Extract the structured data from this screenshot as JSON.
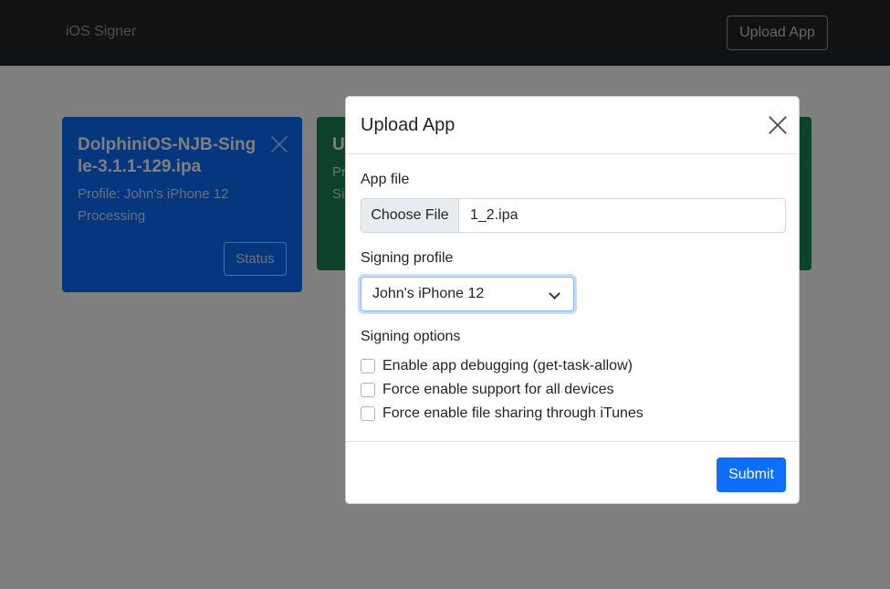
{
  "navbar": {
    "brand": "iOS Signer",
    "upload_button": "Upload App"
  },
  "cards": [
    {
      "title": "DolphiniOS-NJB-Single-3.1.1-129.ipa",
      "profile": "Profile: John's iPhone 12",
      "status_text": "Processing",
      "status_button": "Status",
      "color": "#0d6efd"
    },
    {
      "title": "U",
      "line1": "Pr",
      "line2": "Si",
      "color": "#198754"
    }
  ],
  "modal": {
    "title": "Upload App",
    "app_file_label": "App file",
    "choose_file_button": "Choose File",
    "file_name": "1_2.ipa",
    "signing_profile_label": "Signing profile",
    "signing_profile_value": "John's iPhone 12",
    "signing_options_label": "Signing options",
    "options": [
      {
        "label": "Enable app debugging (get-task-allow)",
        "checked": false
      },
      {
        "label": "Force enable support for all devices",
        "checked": false
      },
      {
        "label": "Force enable file sharing through iTunes",
        "checked": false
      }
    ],
    "submit_button": "Submit"
  },
  "colors": {
    "primary": "#0d6efd",
    "success": "#198754",
    "navbar": "#212529"
  }
}
